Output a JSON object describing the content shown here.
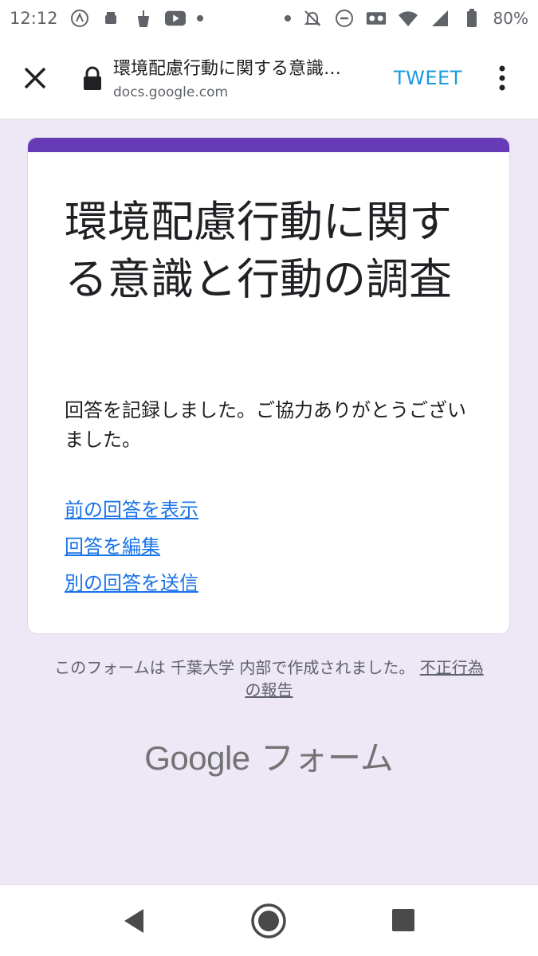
{
  "status_bar": {
    "time": "12:12",
    "battery": "80%"
  },
  "toolbar": {
    "title": "環境配慮行動に関する意識…",
    "url": "docs.google.com",
    "tweet_label": "TWEET"
  },
  "form": {
    "title": "環境配慮行動に関する意識と行動の調査",
    "confirmation": "回答を記録しました。ご協力ありがとうございました。",
    "links": {
      "view_previous": "前の回答を表示",
      "edit_response": "回答を編集",
      "submit_another": "別の回答を送信"
    },
    "accent_color": "#673ab7",
    "background_color": "#ede7f6"
  },
  "footer": {
    "note": "このフォームは 千葉大学 内部で作成されました。 ",
    "report_abuse": "不正行為の報告",
    "brand_google": "Google",
    "brand_forms": " フォーム"
  }
}
